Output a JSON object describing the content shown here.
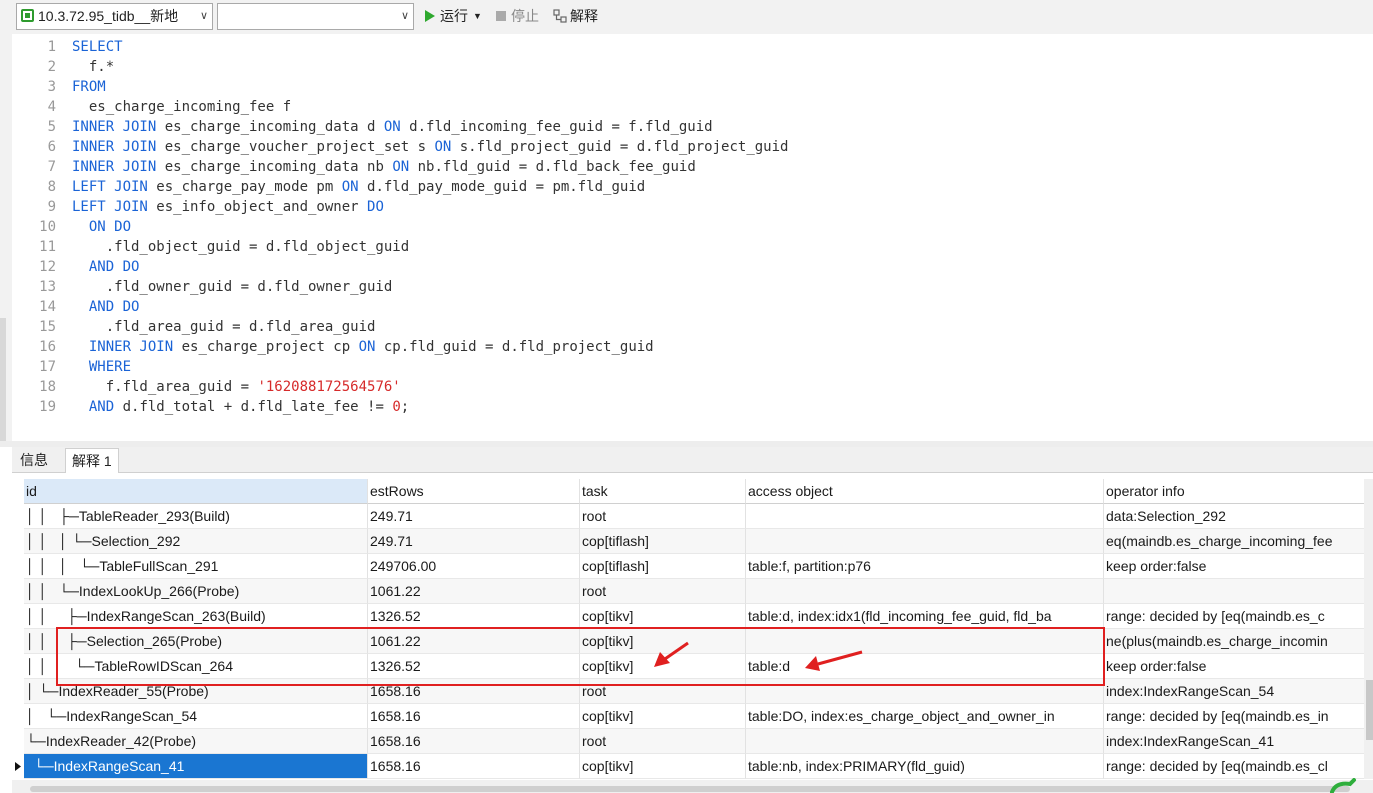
{
  "toolbar": {
    "connection": "10.3.72.95_tidb__新地",
    "database": "",
    "run_label": "运行",
    "stop_label": "停止",
    "explain_label": "解释"
  },
  "editor": {
    "line_numbers": [
      "1",
      "2",
      "3",
      "4",
      "5",
      "6",
      "7",
      "8",
      "9",
      "10",
      "11",
      "12",
      "13",
      "14",
      "15",
      "16",
      "17",
      "18",
      "19"
    ]
  },
  "result_tabs": {
    "info": "信息",
    "explain": "解释 1"
  },
  "grid": {
    "columns": [
      "id",
      "estRows",
      "task",
      "access object",
      "operator info"
    ],
    "rows": [
      {
        "id": "│ │   ├─TableReader_293(Build)",
        "estRows": "249.71",
        "task": "root",
        "access": "",
        "info": "data:Selection_292"
      },
      {
        "id": "│ │   │ └─Selection_292",
        "estRows": "249.71",
        "task": "cop[tiflash]",
        "access": "",
        "info": "eq(maindb.es_charge_incoming_fee"
      },
      {
        "id": "│ │   │   └─TableFullScan_291",
        "estRows": "249706.00",
        "task": "cop[tiflash]",
        "access": "table:f, partition:p76",
        "info": "keep order:false"
      },
      {
        "id": "│ │   └─IndexLookUp_266(Probe)",
        "estRows": "1061.22",
        "task": "root",
        "access": "",
        "info": ""
      },
      {
        "id": "│ │     ├─IndexRangeScan_263(Build)",
        "estRows": "1326.52",
        "task": "cop[tikv]",
        "access": "table:d, index:idx1(fld_incoming_fee_guid, fld_ba",
        "info": "range: decided by [eq(maindb.es_c"
      },
      {
        "id": "│ │     ├─Selection_265(Probe)",
        "estRows": "1061.22",
        "task": "cop[tikv]",
        "access": "",
        "info": "ne(plus(maindb.es_charge_incomin"
      },
      {
        "id": "│ │       └─TableRowIDScan_264",
        "estRows": "1326.52",
        "task": "cop[tikv]",
        "access": "table:d",
        "info": "keep order:false"
      },
      {
        "id": "│ └─IndexReader_55(Probe)",
        "estRows": "1658.16",
        "task": "root",
        "access": "",
        "info": "index:IndexRangeScan_54"
      },
      {
        "id": "│   └─IndexRangeScan_54",
        "estRows": "1658.16",
        "task": "cop[tikv]",
        "access": "table:DO, index:es_charge_object_and_owner_in",
        "info": "range: decided by [eq(maindb.es_in"
      },
      {
        "id": "└─IndexReader_42(Probe)",
        "estRows": "1658.16",
        "task": "root",
        "access": "",
        "info": "index:IndexRangeScan_41"
      },
      {
        "id": "  └─IndexRangeScan_41",
        "estRows": "1658.16",
        "task": "cop[tikv]",
        "access": "table:nb, index:PRIMARY(fld_guid)",
        "info": "range: decided by [eq(maindb.es_cl"
      }
    ]
  }
}
